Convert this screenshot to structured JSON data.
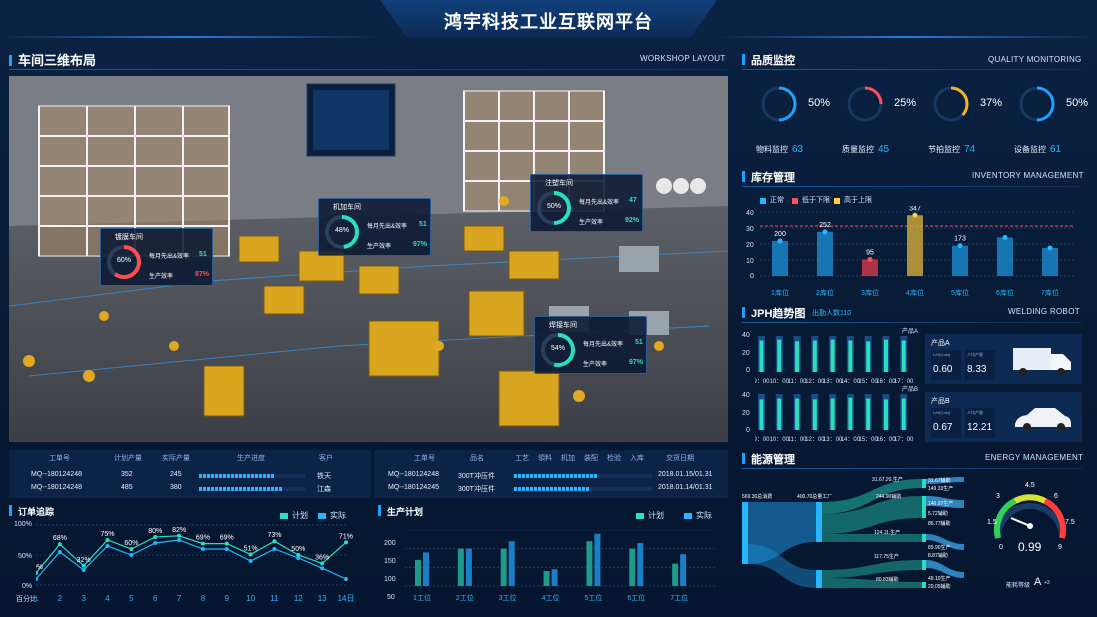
{
  "header": {
    "title": "鸿宇科技工业互联网平台"
  },
  "workshop": {
    "title": "车间三维布局",
    "en": "WORKSHOP LAYOUT",
    "panels": [
      {
        "name": "镀膜车间",
        "pct": "60%",
        "sub": "去年同期",
        "r1_label": "每月先出&效率",
        "r1_val": "51",
        "r2_label": "生产效率",
        "r2_val": "87%",
        "color": "#ff4d4d"
      },
      {
        "name": "机加车间",
        "pct": "48%",
        "sub": "去年同期",
        "r1_label": "每月先出&效率",
        "r1_val": "51",
        "r2_label": "生产效率",
        "r2_val": "97%",
        "color": "#28e0c0"
      },
      {
        "name": "注塑车间",
        "pct": "50%",
        "sub": "去年同期",
        "r1_label": "每月先出&效率",
        "r1_val": "47",
        "r2_label": "生产效率",
        "r2_val": "92%",
        "color": "#28e0c0"
      },
      {
        "name": "焊接车间",
        "pct": "54%",
        "sub": "去年同期",
        "r1_label": "每月先出&效率",
        "r1_val": "51",
        "r2_label": "生产效率",
        "r2_val": "97%",
        "color": "#28e0c0"
      }
    ]
  },
  "table1": {
    "headers": [
      "工单号",
      "计划产量",
      "实际产量",
      "生产进度",
      "客户"
    ],
    "rows": [
      [
        "MQ--180124248",
        "352",
        "245",
        "",
        "铁天"
      ],
      [
        "MQ--180124248",
        "485",
        "380",
        "",
        "江森"
      ]
    ],
    "progress": [
      0.72,
      0.78
    ]
  },
  "table2": {
    "headers": [
      "工单号",
      "品名",
      "工艺",
      "領料",
      "机加",
      "装配",
      "检验",
      "入库",
      "交货日期"
    ],
    "rows": [
      [
        "MQ--180124248",
        "300T冲压件",
        "2018.01.15/01.31"
      ],
      [
        "MQ--180124245",
        "300T冲压件",
        "2018.01.14/01.31"
      ]
    ],
    "progress": [
      0.6,
      0.55
    ]
  },
  "order_track": {
    "title": "订单追踪",
    "legend_plan": "计划",
    "legend_actual": "实际",
    "yticks": [
      "100%",
      "50%",
      "0%"
    ],
    "xlabel": "百分比"
  },
  "prod_plan": {
    "title": "生产计划",
    "legend_plan": "计划",
    "legend_actual": "实际",
    "yticks": [
      "200",
      "150",
      "100",
      "50"
    ],
    "ylabel": "数量"
  },
  "quality": {
    "title": "品质监控",
    "en": "QUALITY MONITORING",
    "items": [
      {
        "pct": "50%",
        "label": "物料监控",
        "num": "63",
        "value": 0.5,
        "color": "#1ea0ff"
      },
      {
        "pct": "25%",
        "label": "质量监控",
        "num": "45",
        "value": 0.25,
        "color": "#ff4d5a"
      },
      {
        "pct": "37%",
        "label": "节拍监控",
        "num": "74",
        "value": 0.37,
        "color": "#ffb020"
      },
      {
        "pct": "50%",
        "label": "设备监控",
        "num": "61",
        "value": 0.5,
        "color": "#1ea0ff"
      }
    ]
  },
  "inventory": {
    "title": "库存管理",
    "en": "INVENTORY MANAGEMENT",
    "leg_normal": "正常",
    "leg_low": "低于下限",
    "leg_high": "高于上限",
    "yticks": [
      "40",
      "30",
      "20",
      "10",
      "0"
    ]
  },
  "jph": {
    "title": "JPH趋势图",
    "sub": "出勤人数110",
    "en": "WELDING ROBOT",
    "xticks": [
      "9：00",
      "10：00",
      "11：00",
      "12：00",
      "13：00",
      "14：00",
      "15：00",
      "16：00",
      "17：00"
    ],
    "yticksA": [
      "40",
      "20",
      "0"
    ],
    "yticksB": [
      "40",
      "20",
      "0"
    ],
    "unit": "产品A",
    "unitB": "产品B",
    "prodA": {
      "name": "产品A",
      "lh_label": "L/H(Cost)",
      "lh": "0.60",
      "out_label": "人均产量",
      "out": "8.33"
    },
    "prodB": {
      "name": "产品B",
      "lh_label": "L/H(Cost)",
      "lh": "0.67",
      "out_label": "人均产量",
      "out": "12.21"
    }
  },
  "energy": {
    "title": "能源管理",
    "en": "ENERGY MANAGEMENT",
    "src": "569.30总消费",
    "mid": "400.70总量工厂",
    "flows": [
      "31.67.20.生产",
      "244.90辅助",
      "124.11.生产",
      "117.75生产",
      "80.83辅助"
    ],
    "right": [
      "31.67辅助",
      "149.33生产",
      "146.97生产",
      "5.72辅助",
      "86.77辅助",
      "89.90生产",
      "8.87辅助",
      "49.10生产",
      "29.05辅助"
    ],
    "gauge": {
      "value": "0.99",
      "ticks": [
        "1.5",
        "3",
        "4.5",
        "6",
        "7.5",
        "0",
        "9"
      ],
      "label": "能耗等级",
      "grade": "A",
      "grade_sub": "+3"
    }
  },
  "chart_data": [
    {
      "type": "line",
      "title": "订单追踪",
      "x": [
        "1",
        "2",
        "3",
        "4",
        "5",
        "6",
        "7",
        "8",
        "9",
        "10",
        "11",
        "12",
        "13",
        "14日"
      ],
      "series": [
        {
          "name": "计划",
          "values": [
            20,
            68,
            32,
            75,
            60,
            80,
            82,
            69,
            69,
            51,
            73,
            50,
            36,
            71
          ]
        },
        {
          "name": "实际",
          "values": [
            10,
            55,
            25,
            65,
            50,
            70,
            75,
            60,
            60,
            40,
            60,
            45,
            28,
            10
          ]
        }
      ],
      "data_labels": [
        "20%",
        "68%",
        "32%",
        "75%",
        "60%",
        "80%",
        "82%",
        "69%",
        "69%",
        "51%",
        "73%",
        "50%",
        "36%",
        "71%"
      ],
      "ylim": [
        0,
        100
      ]
    },
    {
      "type": "bar",
      "title": "生产计划",
      "categories": [
        "1工位",
        "2工位",
        "3工位",
        "4工位",
        "5工位",
        "6工位",
        "7工位"
      ],
      "series": [
        {
          "name": "计划",
          "values": [
            120,
            150,
            150,
            90,
            170,
            150,
            110
          ]
        },
        {
          "name": "实际",
          "values": [
            140,
            150,
            170,
            95,
            190,
            165,
            135
          ]
        }
      ],
      "ylim": [
        50,
        200
      ]
    },
    {
      "type": "bar",
      "title": "库存管理",
      "categories": [
        "1库位",
        "2库位",
        "3库位",
        "4库位",
        "5库位",
        "6库位",
        "7库位"
      ],
      "values": [
        200,
        252,
        95,
        347,
        173,
        220,
        160
      ],
      "labels": [
        "200",
        "252",
        "95",
        "347",
        "173",
        "",
        ""
      ],
      "status": [
        "normal",
        "normal",
        "low",
        "high",
        "normal",
        "normal",
        "normal"
      ]
    },
    {
      "type": "bar",
      "title": "JPH 产品A",
      "categories": [
        "9:00",
        "10:00",
        "11:00",
        "12:00",
        "13:00",
        "14:00",
        "15:00",
        "16:00",
        "17:00"
      ],
      "values": [
        35,
        36,
        34,
        35,
        36,
        35,
        34,
        36,
        35
      ],
      "ylim": [
        0,
        40
      ]
    },
    {
      "type": "bar",
      "title": "JPH 产品B",
      "categories": [
        "9:00",
        "10:00",
        "11:00",
        "12:00",
        "13:00",
        "14:00",
        "15:00",
        "16:00",
        "17:00"
      ],
      "values": [
        34,
        35,
        35,
        34,
        35,
        36,
        35,
        34,
        35
      ],
      "ylim": [
        0,
        40
      ]
    }
  ]
}
